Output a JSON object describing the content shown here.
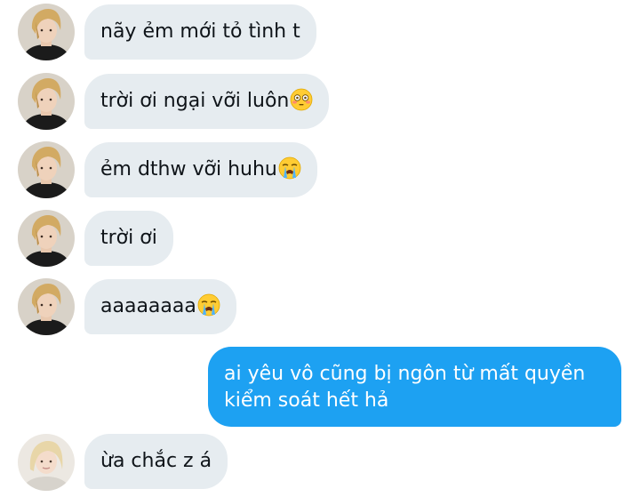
{
  "conversation": {
    "messages": [
      {
        "sender": "other",
        "avatar": "avatar-1",
        "text": "nãy ẻm mới tỏ tình t"
      },
      {
        "sender": "other",
        "avatar": "avatar-1",
        "text": "trời ơi ngại vỡi luôn",
        "emoji": "flushed-face"
      },
      {
        "sender": "other",
        "avatar": "avatar-1",
        "text": "ẻm dthw vỡi huhu",
        "emoji": "loudly-crying-face"
      },
      {
        "sender": "other",
        "avatar": "avatar-1",
        "text": "trời ơi"
      },
      {
        "sender": "other",
        "avatar": "avatar-1",
        "text": "aaaaaaaa",
        "emoji": "loudly-crying-face"
      },
      {
        "sender": "me",
        "text": "ai yêu vô cũng bị ngôn từ mất quyền kiểm soát hết hả"
      },
      {
        "sender": "other",
        "avatar": "avatar-2",
        "text": "ừa chắc z á"
      }
    ]
  },
  "colors": {
    "incoming_bubble": "#e6ecf0",
    "outgoing_bubble": "#1da1f2",
    "incoming_text": "#0f1419",
    "outgoing_text": "#ffffff"
  }
}
